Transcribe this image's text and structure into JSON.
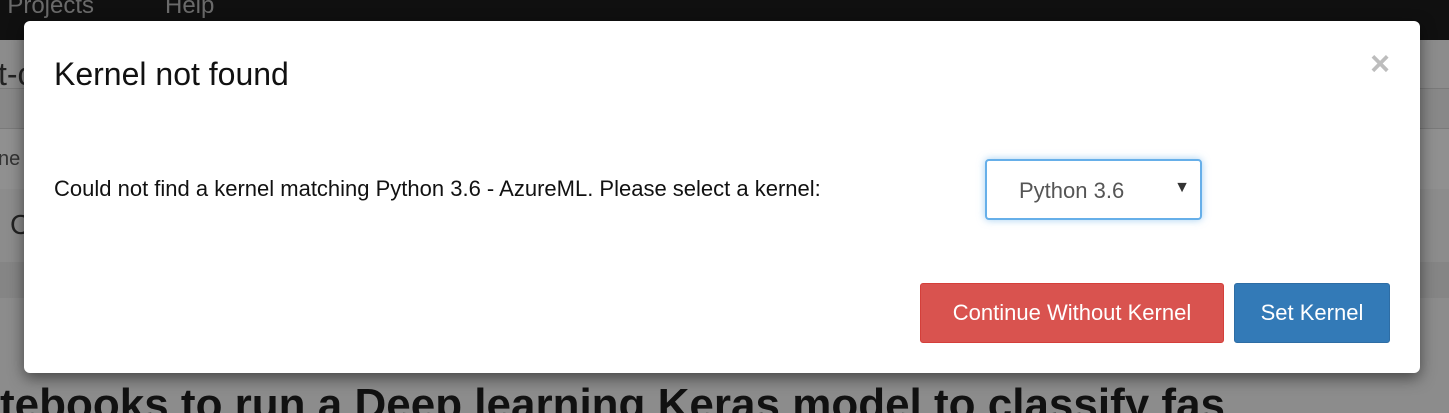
{
  "background": {
    "nav_items": [
      "/ Projects",
      "Help"
    ],
    "left_fragments": [
      "t-c",
      "ne",
      "C"
    ],
    "heading_fragment": "tebooks to run a Deep learning Keras model to classify fas"
  },
  "modal": {
    "title": "Kernel not found",
    "close_glyph": "×",
    "message": "Could not find a kernel matching Python 3.6 - AzureML. Please select a kernel:",
    "kernel_select": {
      "selected": "Python 3.6",
      "arrow_glyph": "▼"
    },
    "buttons": {
      "continue_label": "Continue Without Kernel",
      "set_label": "Set Kernel"
    }
  },
  "colors": {
    "danger": "#d9534f",
    "primary": "#337ab7",
    "focus": "#66afe9"
  }
}
